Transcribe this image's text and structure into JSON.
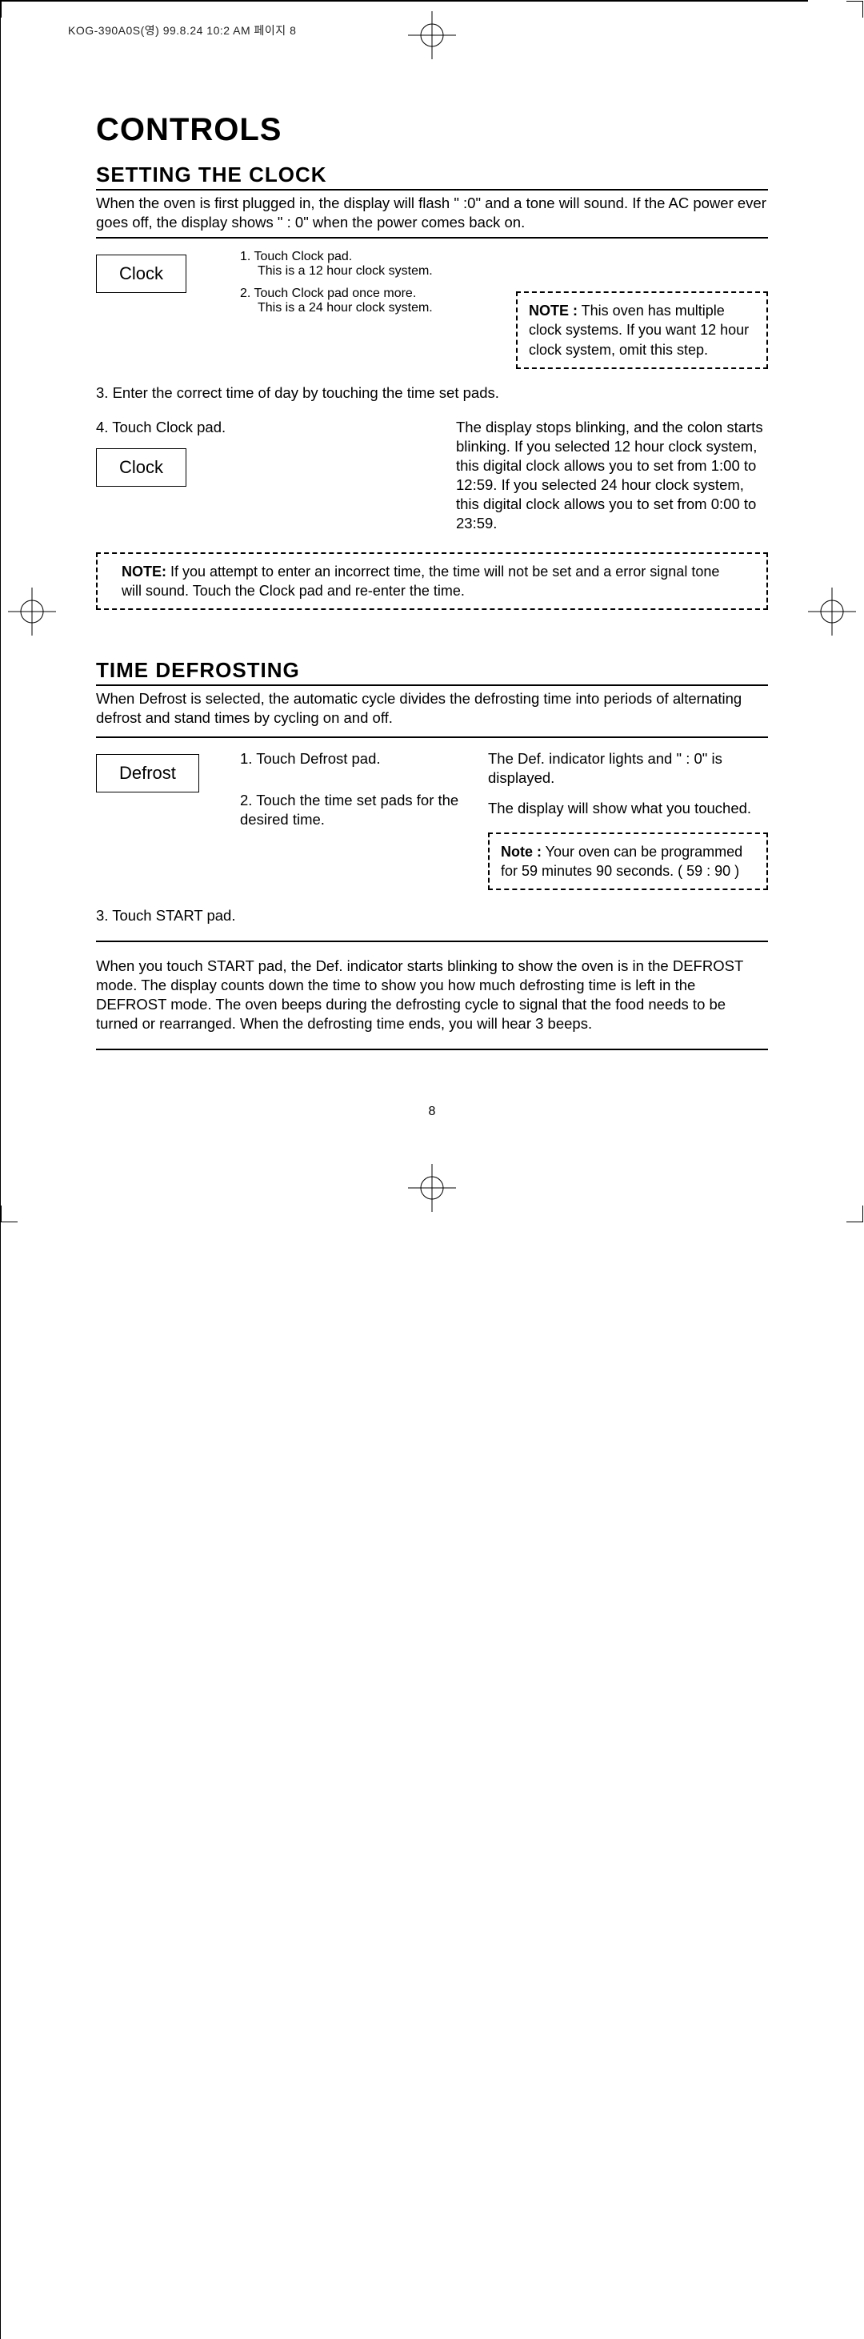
{
  "meta_header": "KOG-390A0S(영)  99.8.24 10:2 AM  페이지 8",
  "page_number": "8",
  "title": "CONTROLS",
  "clock": {
    "heading": "SETTING THE CLOCK",
    "intro": "When the oven is first plugged in, the display will flash \" :0\" and a tone will sound. If the AC power ever goes off, the display shows \" : 0\" when the power comes back on.",
    "pad_label": "Clock",
    "step1a": "1.  Touch Clock pad.",
    "step1b": "This is a 12 hour clock system.",
    "step2a": "2. Touch Clock pad once more.",
    "step2b": "This is a 24 hour clock system.",
    "note1_label": "NOTE :",
    "note1": " This oven has multiple clock systems. If you want 12 hour clock system, omit this step.",
    "step3": "3. Enter the correct time of day by touching the time set pads.",
    "step4": "4. Touch Clock pad.",
    "result": "The display stops blinking, and the colon starts blinking. If you selected 12 hour clock system, this digital clock allows you to set from 1:00 to 12:59. If you selected 24 hour clock system, this digital clock allows you to set from 0:00 to 23:59.",
    "note2_label": "NOTE:",
    "note2": " If you attempt to enter an incorrect time, the time will not be set and a error signal tone will sound. Touch the Clock pad and re-enter the time."
  },
  "defrost": {
    "heading": "TIME DEFROSTING",
    "intro": "When Defrost is selected, the automatic cycle divides the defrosting time into periods of alternating defrost and stand times by cycling on and off.",
    "pad_label": "Defrost",
    "step1": "1. Touch Defrost pad.",
    "result1": "The Def. indicator lights and \" : 0\" is displayed.",
    "step2": "2. Touch the time set pads for the desired time.",
    "result2": "The display will show what you touched.",
    "note_label": "Note :",
    "note": " Your oven can be programmed for 59 minutes 90 seconds. ( 59 : 90 )",
    "step3": "3. Touch START pad.",
    "outro": "When you touch START pad, the Def. indicator starts blinking to show the oven is in the DEFROST mode. The display counts down the time to show you how much defrosting time is left in the DEFROST mode. The oven beeps during the defrosting cycle to signal that the food needs to be turned or rearranged. When the defrosting time ends, you will hear 3 beeps."
  }
}
